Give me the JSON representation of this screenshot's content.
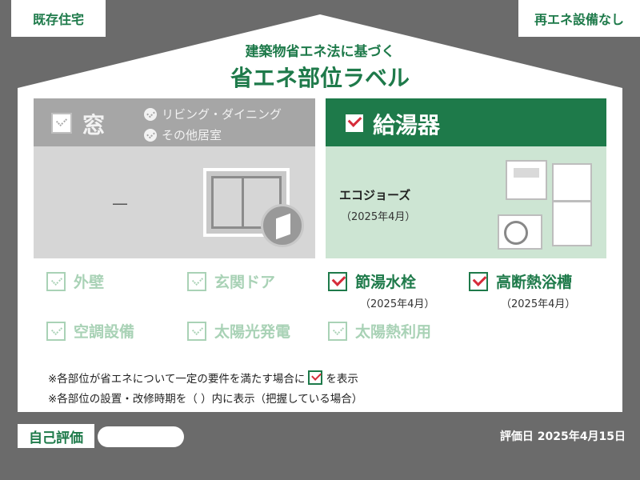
{
  "colors": {
    "brand_green": "#1e7a4a",
    "background_grey": "#6b6b6b",
    "check_red": "#d62b3a"
  },
  "tags": {
    "top_left": "既存住宅",
    "top_right": "再エネ設備なし"
  },
  "header": {
    "subtitle": "建築物省エネ法に基づく",
    "title": "省エネ部位ラベル"
  },
  "window_panel": {
    "label": "窓",
    "checked": false,
    "rooms": [
      "リビング・ダイニング",
      "その他居室"
    ],
    "value": "—"
  },
  "water_heater_panel": {
    "label": "給湯器",
    "checked": true,
    "product": "エコジョーズ",
    "date": "（2025年4月）"
  },
  "items": [
    {
      "label": "外壁",
      "checked": false,
      "date": ""
    },
    {
      "label": "玄関ドア",
      "checked": false,
      "date": ""
    },
    {
      "label": "節湯水栓",
      "checked": true,
      "date": "（2025年4月）"
    },
    {
      "label": "高断熱浴槽",
      "checked": true,
      "date": "（2025年4月）"
    },
    {
      "label": "空調設備",
      "checked": false,
      "date": ""
    },
    {
      "label": "太陽光発電",
      "checked": false,
      "date": ""
    },
    {
      "label": "太陽熱利用",
      "checked": false,
      "date": ""
    }
  ],
  "notes": {
    "line1_before": "※各部位が省エネについて一定の要件を満たす場合に",
    "line1_after": "を表示",
    "line2": "※各部位の設置・改修時期を（ ）内に表示（把握している場合）"
  },
  "footer": {
    "self_eval": "自己評価",
    "eval_date": "評価日 2025年4月15日"
  }
}
